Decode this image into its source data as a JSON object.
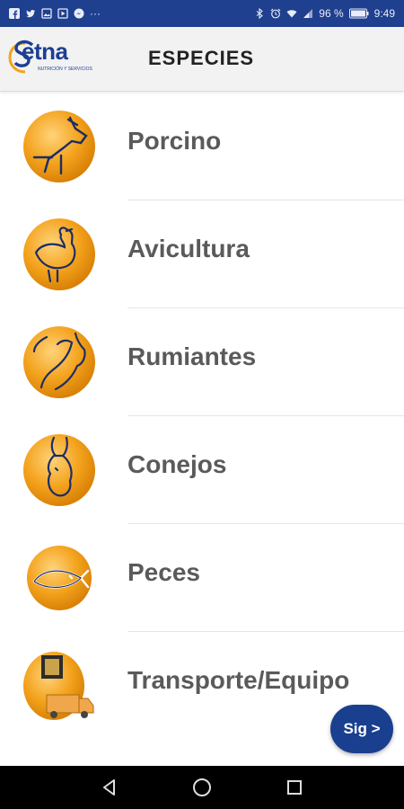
{
  "status_bar": {
    "battery_percent": "96 %",
    "time": "9:49",
    "icons": [
      "facebook-icon",
      "twitter-icon",
      "gallery-icon",
      "play-store-icon",
      "messenger-icon",
      "more-dots-icon",
      "bluetooth-icon",
      "alarm-icon",
      "wifi-icon",
      "signal-icon",
      "battery-icon"
    ]
  },
  "header": {
    "logo_text": "etna",
    "logo_tagline": "NUTRICIÓN Y SERVICIOS",
    "title": "ESPECIES"
  },
  "species": [
    {
      "label": "Porcino",
      "icon": "pig-icon"
    },
    {
      "label": "Avicultura",
      "icon": "chicken-icon"
    },
    {
      "label": "Rumiantes",
      "icon": "cow-icon"
    },
    {
      "label": "Conejos",
      "icon": "rabbit-icon"
    },
    {
      "label": "Peces",
      "icon": "fish-icon"
    },
    {
      "label": "Transporte/Equipo",
      "icon": "truck-icon"
    }
  ],
  "next_button": {
    "label": "Sig >"
  },
  "colors": {
    "status_bar": "#1f3f8f",
    "brand_blue": "#1c3f93",
    "icon_orange": "#f3a21c",
    "label_gray": "#5a5a5a"
  }
}
